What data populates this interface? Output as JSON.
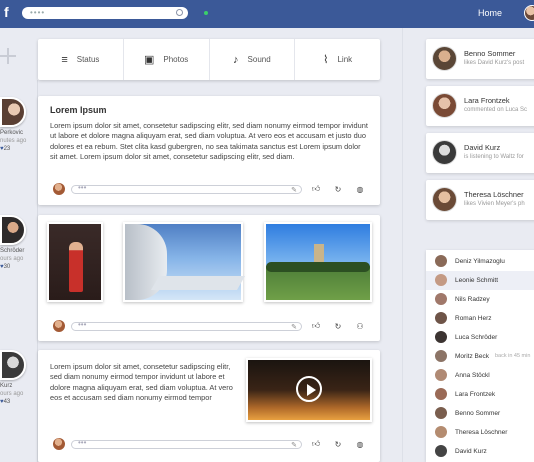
{
  "topbar": {
    "logo": "f",
    "search_placeholder": "••••",
    "home_label": "Home"
  },
  "composer": {
    "items": [
      {
        "label": "Status",
        "icon": "list-icon"
      },
      {
        "label": "Photos",
        "icon": "photos-icon"
      },
      {
        "label": "Sound",
        "icon": "music-note-icon"
      },
      {
        "label": "Link",
        "icon": "paperclip-icon"
      }
    ]
  },
  "posts": [
    {
      "author": "Perkovic",
      "time": "nutes ago",
      "likes": "23",
      "title": "Lorem Ipsum",
      "text": "Lorem ipsum dolor sit amet, consetetur sadipscing elitr, sed diam nonumy eirmod tempor invidunt ut labore et dolore magna aliquyam erat, sed diam voluptua. At vero eos et accusam et justo duo dolores et ea rebum. Stet clita kasd gubergren, no sea takimata sanctus est Lorem ipsum dolor sit amet. Lorem ipsum dolor sit amet, consetetur sadipscing elitr, sed diam."
    },
    {
      "author": "Schröder",
      "time": "ours ago",
      "likes": "30"
    },
    {
      "author": "Kurz",
      "time": "ours ago",
      "likes": "43",
      "text": "Lorem ipsum dolor sit amet, consetetur sadipscing elitr, sed diam nonumy eirmod tempor invidunt ut labore et dolore magna aliquyam erat, sed diam voluptua. At vero eos et accusam sed diam nonumy eirmod tempor"
    }
  ],
  "comment": {
    "placeholder": "•••"
  },
  "activity": [
    {
      "name": "Benno Sommer",
      "sub": "likes David Kurz's post"
    },
    {
      "name": "Lara Frontzek",
      "sub": "commented on Luca Sc"
    },
    {
      "name": "David Kurz",
      "sub": "is listening to Waltz for"
    },
    {
      "name": "Theresa Löschner",
      "sub": "likes Vivien Meyer's ph"
    }
  ],
  "friends": [
    {
      "name": "Deniz Yilmazoglu",
      "time": ""
    },
    {
      "name": "Leonie Schmitt",
      "time": ""
    },
    {
      "name": "Nils Radzey",
      "time": ""
    },
    {
      "name": "Roman Herz",
      "time": ""
    },
    {
      "name": "Luca Schröder",
      "time": ""
    },
    {
      "name": "Moritz Beck",
      "time": "back in 45 min"
    },
    {
      "name": "Anna Stöckl",
      "time": ""
    },
    {
      "name": "Lara Frontzek",
      "time": ""
    },
    {
      "name": "Benno Sommer",
      "time": ""
    },
    {
      "name": "Theresa Löschner",
      "time": ""
    },
    {
      "name": "David Kurz",
      "time": ""
    }
  ],
  "colors": {
    "brand": "#3b5998",
    "online": "#3ad06a"
  }
}
